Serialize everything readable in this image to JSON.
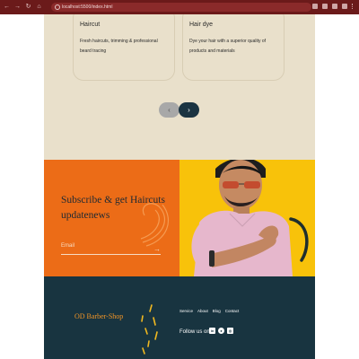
{
  "browser": {
    "url": "localhost:5500/index.html"
  },
  "services": {
    "cards": [
      {
        "title": "Haircut",
        "description": "Fresh haircuts, trimming & professional beard tracing"
      },
      {
        "title": "Hair dye",
        "description": "Dye your hair with a superior quality of products and materials"
      }
    ],
    "prev_arrow": "‹",
    "next_arrow": "›"
  },
  "subscribe": {
    "title": "Subscribe & get Haircuts updatenews",
    "email_label": "Email",
    "send_icon": "arrow-right-icon"
  },
  "footer": {
    "brand": "OD Barber-Shop",
    "links": [
      "Service",
      "About",
      "Blog",
      "Contact"
    ],
    "follow_label": "Follow us on:",
    "socials": [
      {
        "icon": "linkedin-icon",
        "glyph": "in"
      },
      {
        "icon": "github-icon",
        "glyph": "●"
      },
      {
        "icon": "instagram-icon",
        "glyph": "◎"
      }
    ]
  },
  "colors": {
    "services_bg": "#e9e0cb",
    "subscribe_bg": "#ec6c17",
    "photo_bg": "#f8c20a",
    "footer_bg": "#183440",
    "brand_accent": "#f09426"
  }
}
